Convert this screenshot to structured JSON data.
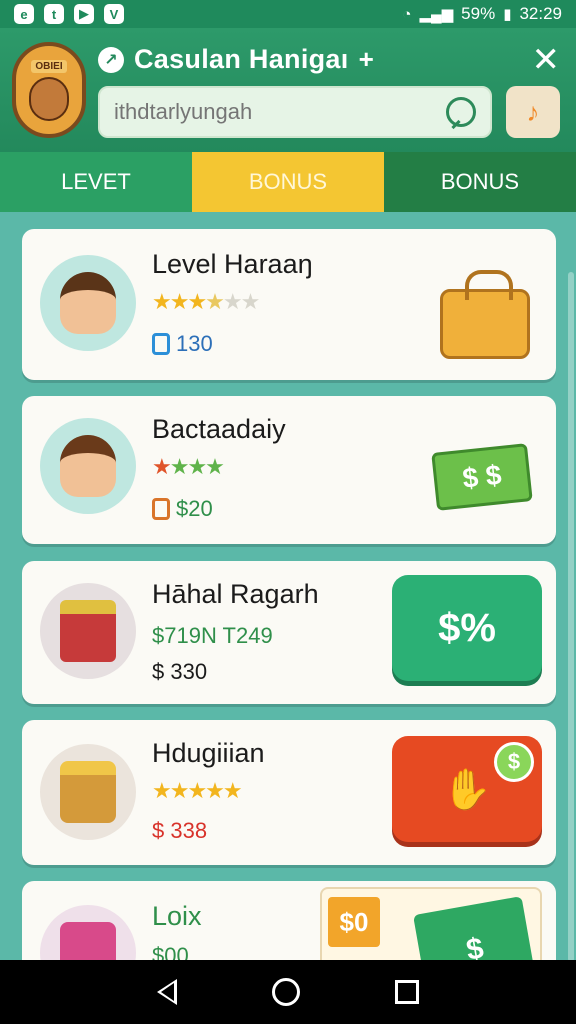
{
  "status_bar": {
    "apps": [
      "e",
      "t",
      "▶",
      "V"
    ],
    "signal_label": "59%",
    "time": "32:29"
  },
  "header": {
    "logo_text": "OBIEI",
    "title": "Casulan Hanigaı",
    "plus": "+",
    "close": "✕",
    "search": {
      "value": "",
      "placeholder": "ithdtarlyungah"
    },
    "action_icon": "pin-icon"
  },
  "tabs": [
    {
      "label": "LEVET"
    },
    {
      "label": "BONUS"
    },
    {
      "label": "BONUS"
    }
  ],
  "cards": [
    {
      "title": "Level Haraaŋ",
      "stars": "3.5/6",
      "value": "130",
      "side": "bag-icon"
    },
    {
      "title": "Bactaadaiy",
      "stars": "4",
      "value": "$20",
      "side": "cash-icon",
      "cash_symbol": "$ $"
    },
    {
      "title": "Hāhal Ragarh",
      "line1": "$719N T249",
      "value": "$ 330",
      "button": "$%"
    },
    {
      "title": "Hdugiiian",
      "value": "$ 338",
      "button": "✋",
      "coin": "$"
    },
    {
      "title": "Loix",
      "value": "$00",
      "tag": "$0",
      "cash": "$"
    }
  ]
}
